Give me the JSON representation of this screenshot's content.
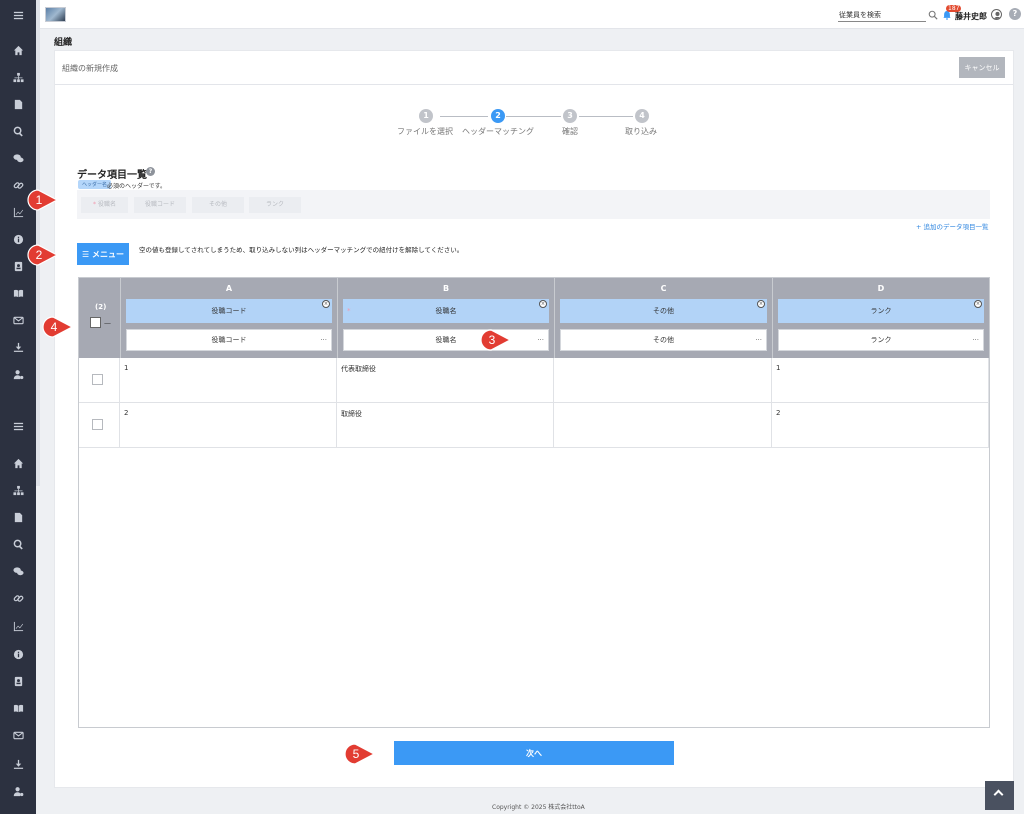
{
  "topbar": {
    "search_placeholder": "従業員を検索",
    "notification_count": "187",
    "user_name": "藤井史郎",
    "help": "?"
  },
  "page": {
    "title": "組織"
  },
  "card": {
    "title": "組織の新規作成",
    "cancel_label": "キャンセル"
  },
  "stepper": {
    "steps": [
      {
        "num": "1",
        "label": "ファイルを選択",
        "active": false
      },
      {
        "num": "2",
        "label": "ヘッダーマッチング",
        "active": true
      },
      {
        "num": "3",
        "label": "確認",
        "active": false
      },
      {
        "num": "4",
        "label": "取り込み",
        "active": false
      }
    ]
  },
  "data_items": {
    "title": "データ項目一覧",
    "required_chip": "ヘッダー名",
    "required_text": "必須のヘッダーです。",
    "fields": [
      "役職名",
      "役職コード",
      "その他",
      "ランク"
    ],
    "add_link": "+ 追加のデータ項目一覧"
  },
  "menu": {
    "label": "☰ メニュー",
    "note": "空の値も登録してされてしまうため、取り込みしない列はヘッダーマッチングでの紐付けを解除してください。"
  },
  "grid": {
    "select_label": "(2)",
    "select_dash": "—",
    "columns": [
      {
        "letter": "A",
        "header": "役職コード",
        "select": "役職コード",
        "required": false
      },
      {
        "letter": "B",
        "header": "役職名",
        "select": "役職名",
        "required": true
      },
      {
        "letter": "C",
        "header": "その他",
        "select": "その他",
        "required": false
      },
      {
        "letter": "D",
        "header": "ランク",
        "select": "ランク",
        "required": false
      }
    ],
    "rows": [
      [
        "1",
        "代表取締役",
        "",
        "1"
      ],
      [
        "2",
        "取締役",
        "",
        "2"
      ]
    ]
  },
  "next_label": "次へ",
  "footer": {
    "copyright": "Copyright © 2025 株式会社ttoA"
  },
  "callouts": [
    "1",
    "2",
    "3",
    "4",
    "5"
  ],
  "colors": {
    "accent": "#3b99f5",
    "sidebar": "#2c3140",
    "callout": "#e23c32"
  }
}
